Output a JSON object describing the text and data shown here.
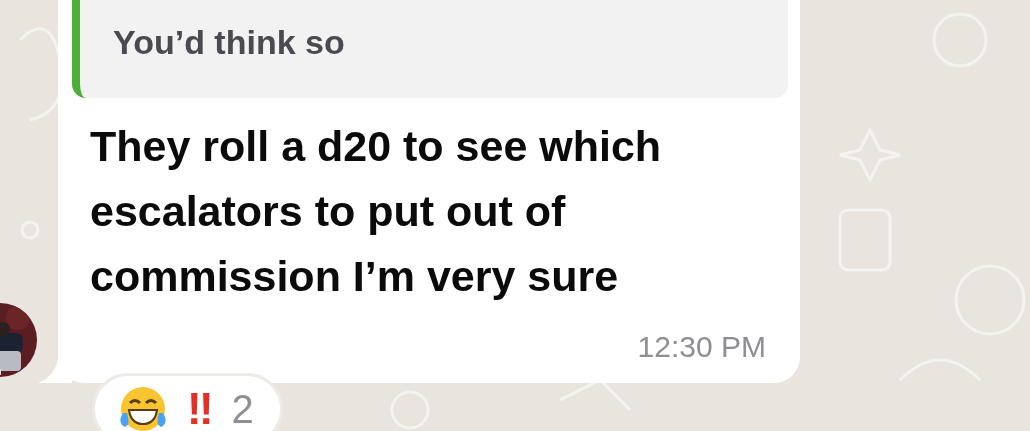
{
  "reply": {
    "quoted_text": "You’d think so"
  },
  "message": {
    "text": "They roll a d20 to see which escalators to put out of commission I’m very sure",
    "time": "12:30 PM"
  },
  "reaction": {
    "mark": "‼",
    "count": "2"
  }
}
